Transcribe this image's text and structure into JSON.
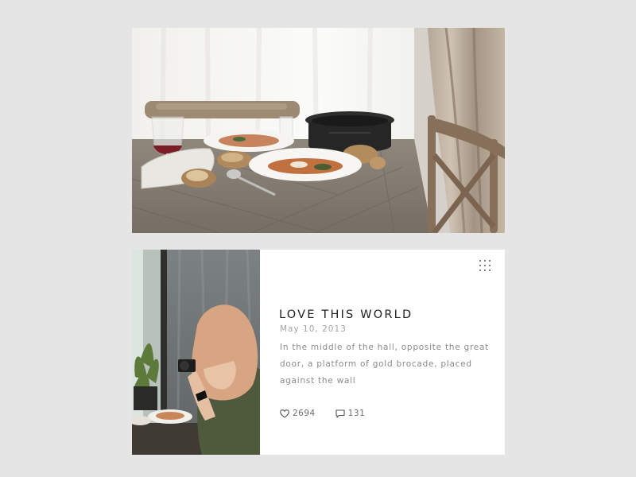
{
  "post": {
    "title": "LOVE THIS WORLD",
    "date": "May 10, 2013",
    "body": "In the middle of the hall, opposite the great door, a platform of gold brocade, placed against the wall",
    "likes": "2694",
    "comments": "131"
  },
  "icons": {
    "menu": "grid-dots-icon",
    "like": "heart-icon",
    "comment": "speech-bubble-icon"
  },
  "colors": {
    "background": "#e5e5e5",
    "card": "#ffffff",
    "title": "#222222",
    "meta": "#a5a5a5",
    "body_text": "#8a8a8a"
  }
}
